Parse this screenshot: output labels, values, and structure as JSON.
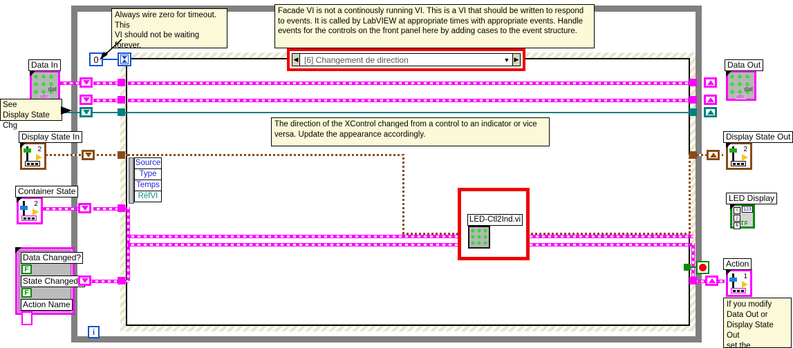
{
  "diagram": {
    "type": "labview-block-diagram",
    "case_selector": {
      "label": "[6] Changement de direction",
      "left_arrow": "◀",
      "right_arrow": "▶",
      "dropdown_arrow": "▼",
      "highlight_color": "#ee0000"
    },
    "timeout": {
      "constant": "0",
      "node_icon": "⧖"
    },
    "iteration_terminal": "i"
  },
  "comments": {
    "timeout": "Always wire zero for timeout. This\nVI should not be waiting\nforever.",
    "facade": "Facade VI is not a continously running VI.  This is a VI that should be written to respond to events.  It is called by LabVIEW at appropriate times with appropriate events. Handle events for the controls on the front panel here by adding cases to the event structure.",
    "direction": "The direction of the XControl changed from a control to an indicator or vice versa. Update the appearance accordingly.",
    "see_display_state": "See\nDisplay State Chg",
    "modify": "If you modify\nData Out or\nDisplay State Out\nset the\nappropriate"
  },
  "terminals": {
    "data_in": {
      "label": "Data In",
      "tag": "abc",
      "inner_tag": "dat",
      "color": "#ff00ff"
    },
    "data_out": {
      "label": "Data Out",
      "tag": "abc",
      "inner_tag": "dat",
      "color": "#ff00ff"
    },
    "display_state_in": {
      "label": "Display State In",
      "number": "2",
      "color": "#8a4b12"
    },
    "display_state_out": {
      "label": "Display State Out",
      "number": "2",
      "color": "#8a4b12"
    },
    "container_state": {
      "label": "Container State",
      "number": "2",
      "color": "#ff00ff"
    },
    "led_display": {
      "label": "LED Display",
      "cells": [
        "i",
        "j",
        "k"
      ],
      "numeric": "123",
      "tf": "TF",
      "color": "#0a8a0a"
    },
    "action": {
      "label": "Action",
      "number": "1",
      "color": "#ff00ff"
    }
  },
  "unbundle": {
    "items": [
      {
        "label": "Source",
        "color": "#2222dd"
      },
      {
        "label": "Type",
        "color": "#2222dd"
      },
      {
        "label": "Temps",
        "color": "#2222dd"
      },
      {
        "label": "RéfVI",
        "color": "#0f8a8a"
      }
    ]
  },
  "cluster_constant": {
    "fields": [
      {
        "label": "Data Changed?",
        "value": "F",
        "type": "boolean"
      },
      {
        "label": "State Changed?",
        "value": "F",
        "type": "boolean"
      },
      {
        "label": "Action Name",
        "value": "",
        "type": "string"
      }
    ]
  },
  "subvi": {
    "label": "LED-Ctl2Ind.vi",
    "highlight_color": "#ee0000"
  },
  "stop_button": {
    "name": "stop-constant",
    "color": "#ee0000"
  },
  "colors": {
    "loop_border": "#808080",
    "event_border": "#e8e4cc",
    "cluster_wire": "#ff00ff",
    "refnum_wire": "#008080",
    "display_state_wire": "#8a4b12",
    "comment_bg": "#fbf9d8"
  }
}
